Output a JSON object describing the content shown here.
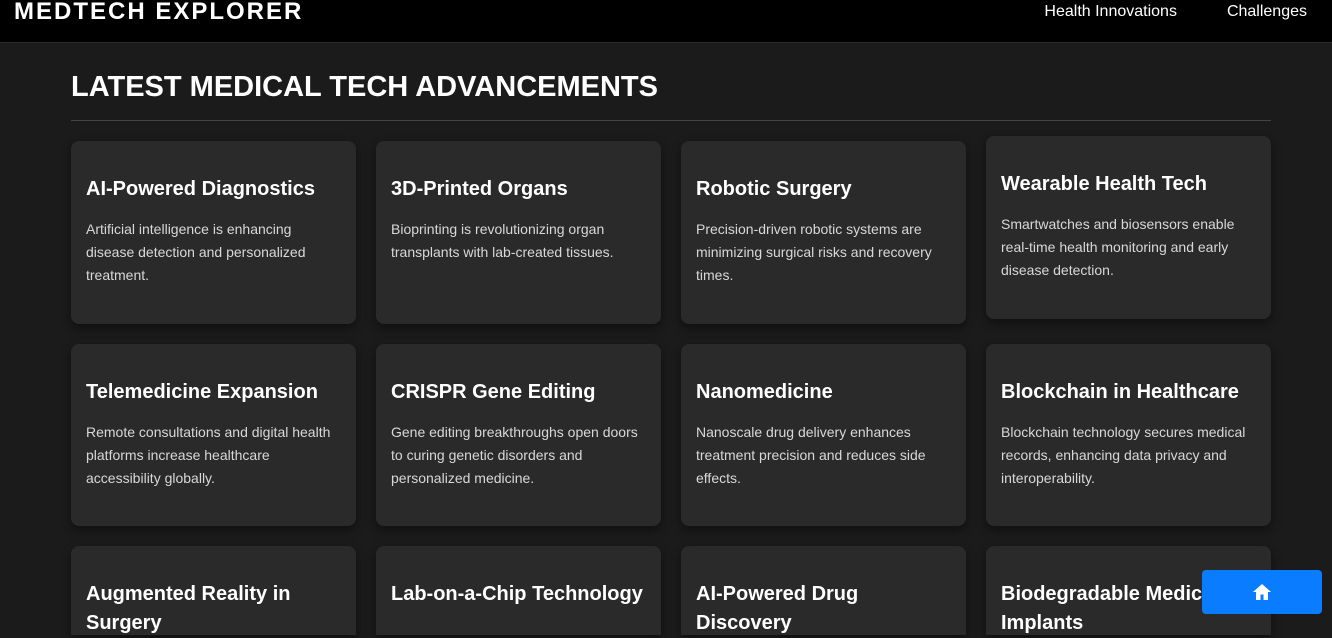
{
  "header": {
    "brand": "MEDTECH EXPLORER",
    "nav": [
      "Health Innovations",
      "Challenges"
    ]
  },
  "main": {
    "title": "LATEST MEDICAL TECH ADVANCEMENTS",
    "cards": [
      {
        "title": "AI-Powered Diagnostics",
        "desc": "Artificial intelligence is enhancing disease detection and personalized treatment."
      },
      {
        "title": "3D-Printed Organs",
        "desc": "Bioprinting is revolutionizing organ transplants with lab-created tissues."
      },
      {
        "title": "Robotic Surgery",
        "desc": "Precision-driven robotic systems are minimizing surgical risks and recovery times."
      },
      {
        "title": "Wearable Health Tech",
        "desc": "Smartwatches and biosensors enable real-time health monitoring and early disease detection."
      },
      {
        "title": "Telemedicine Expansion",
        "desc": "Remote consultations and digital health platforms increase healthcare accessibility globally."
      },
      {
        "title": "CRISPR Gene Editing",
        "desc": "Gene editing breakthroughs open doors to curing genetic disorders and personalized medicine."
      },
      {
        "title": "Nanomedicine",
        "desc": "Nanoscale drug delivery enhances treatment precision and reduces side effects."
      },
      {
        "title": "Blockchain in Healthcare",
        "desc": "Blockchain technology secures medical records, enhancing data privacy and interoperability."
      },
      {
        "title": "Augmented Reality in Surgery",
        "desc": ""
      },
      {
        "title": "Lab-on-a-Chip Technology",
        "desc": ""
      },
      {
        "title": "AI-Powered Drug Discovery",
        "desc": ""
      },
      {
        "title": "Biodegradable Medical Implants",
        "desc": ""
      }
    ]
  },
  "home_button": {
    "icon": "home-icon"
  },
  "colors": {
    "accent": "#0a7cff",
    "background": "#1b1b1b",
    "card": "#2a2a2a",
    "header": "#000000"
  }
}
